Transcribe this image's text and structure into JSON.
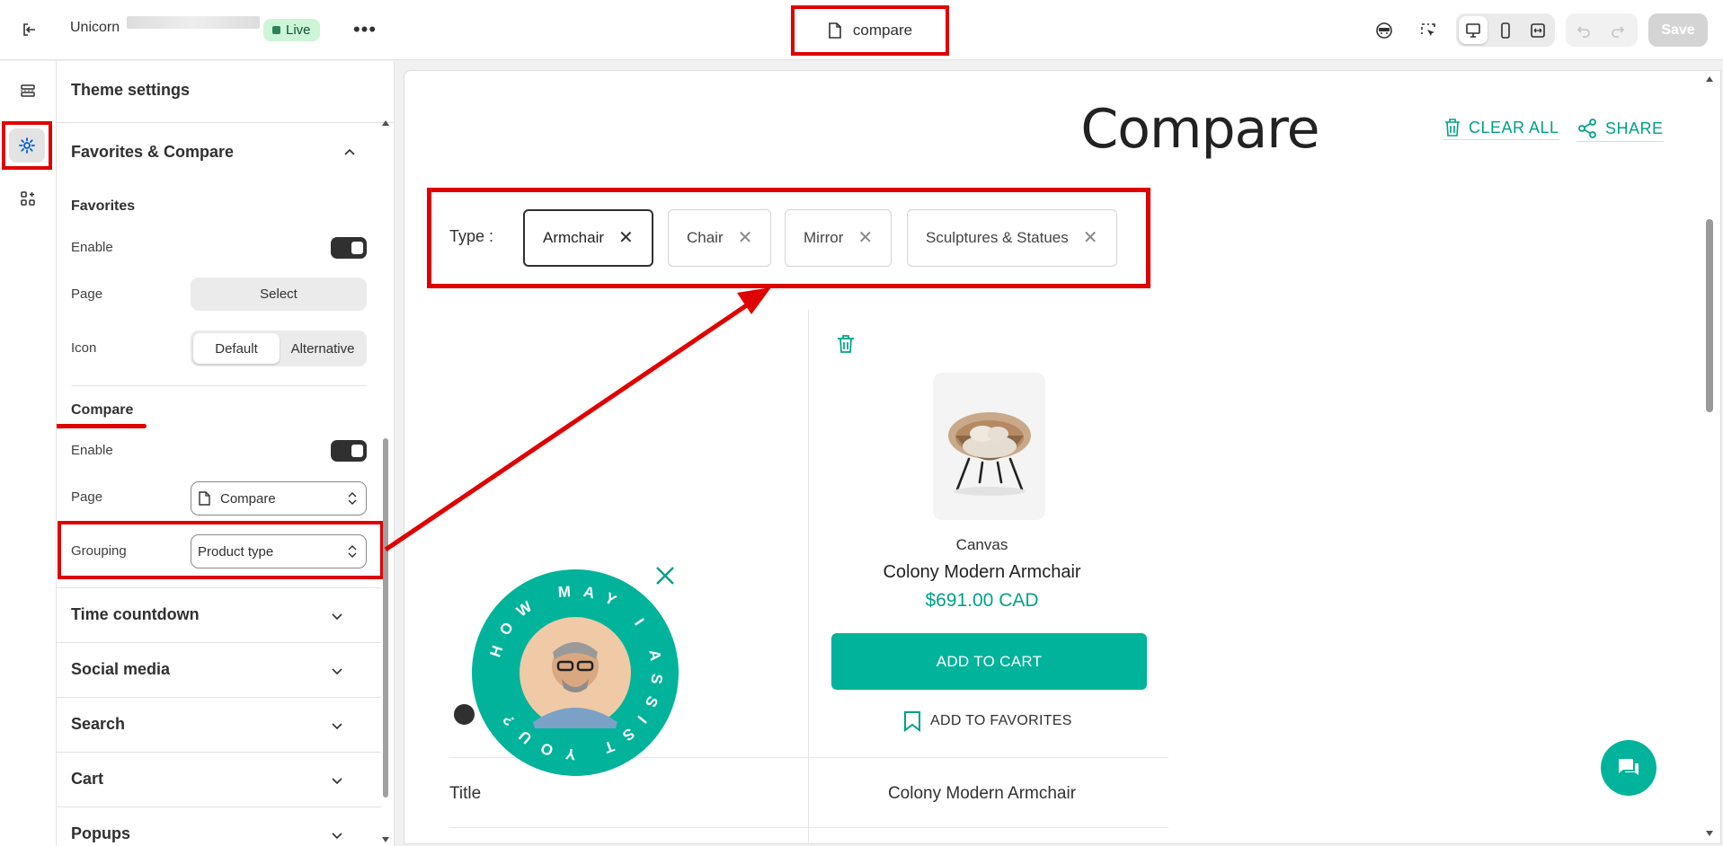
{
  "topbar": {
    "store_name": "Unicorn",
    "live_label": "Live",
    "page_name": "compare",
    "save_label": "Save"
  },
  "panel": {
    "title": "Theme settings",
    "section_title": "Favorites & Compare",
    "favorites": {
      "heading": "Favorites",
      "enable_label": "Enable",
      "page_label": "Page",
      "page_button": "Select",
      "icon_label": "Icon",
      "icon_options": [
        "Default",
        "Alternative"
      ],
      "icon_selected": "Default"
    },
    "compare": {
      "heading": "Compare",
      "enable_label": "Enable",
      "page_label": "Page",
      "page_value": "Compare",
      "grouping_label": "Grouping",
      "grouping_value": "Product type"
    },
    "collapsed_sections": [
      "Time countdown",
      "Social media",
      "Search",
      "Cart",
      "Popups"
    ]
  },
  "preview": {
    "title": "Compare",
    "clear_all": "CLEAR ALL",
    "share": "SHARE",
    "type_label": "Type :",
    "type_chips": [
      "Armchair",
      "Chair",
      "Mirror",
      "Sculptures & Statues"
    ],
    "active_chip": "Armchair",
    "product": {
      "vendor": "Canvas",
      "name": "Colony Modern Armchair",
      "price": "$691.00 CAD",
      "add_to_cart": "ADD TO CART",
      "add_to_favorites": "ADD TO FAVORITES"
    },
    "table": {
      "title_label": "Title",
      "title_value": "Colony Modern Armchair"
    },
    "assist_text": "HOW MAY I ASSIST YOU?"
  },
  "colors": {
    "accent": "#00b39a",
    "highlight": "#e00000",
    "live_bg": "#cdf5d8"
  }
}
